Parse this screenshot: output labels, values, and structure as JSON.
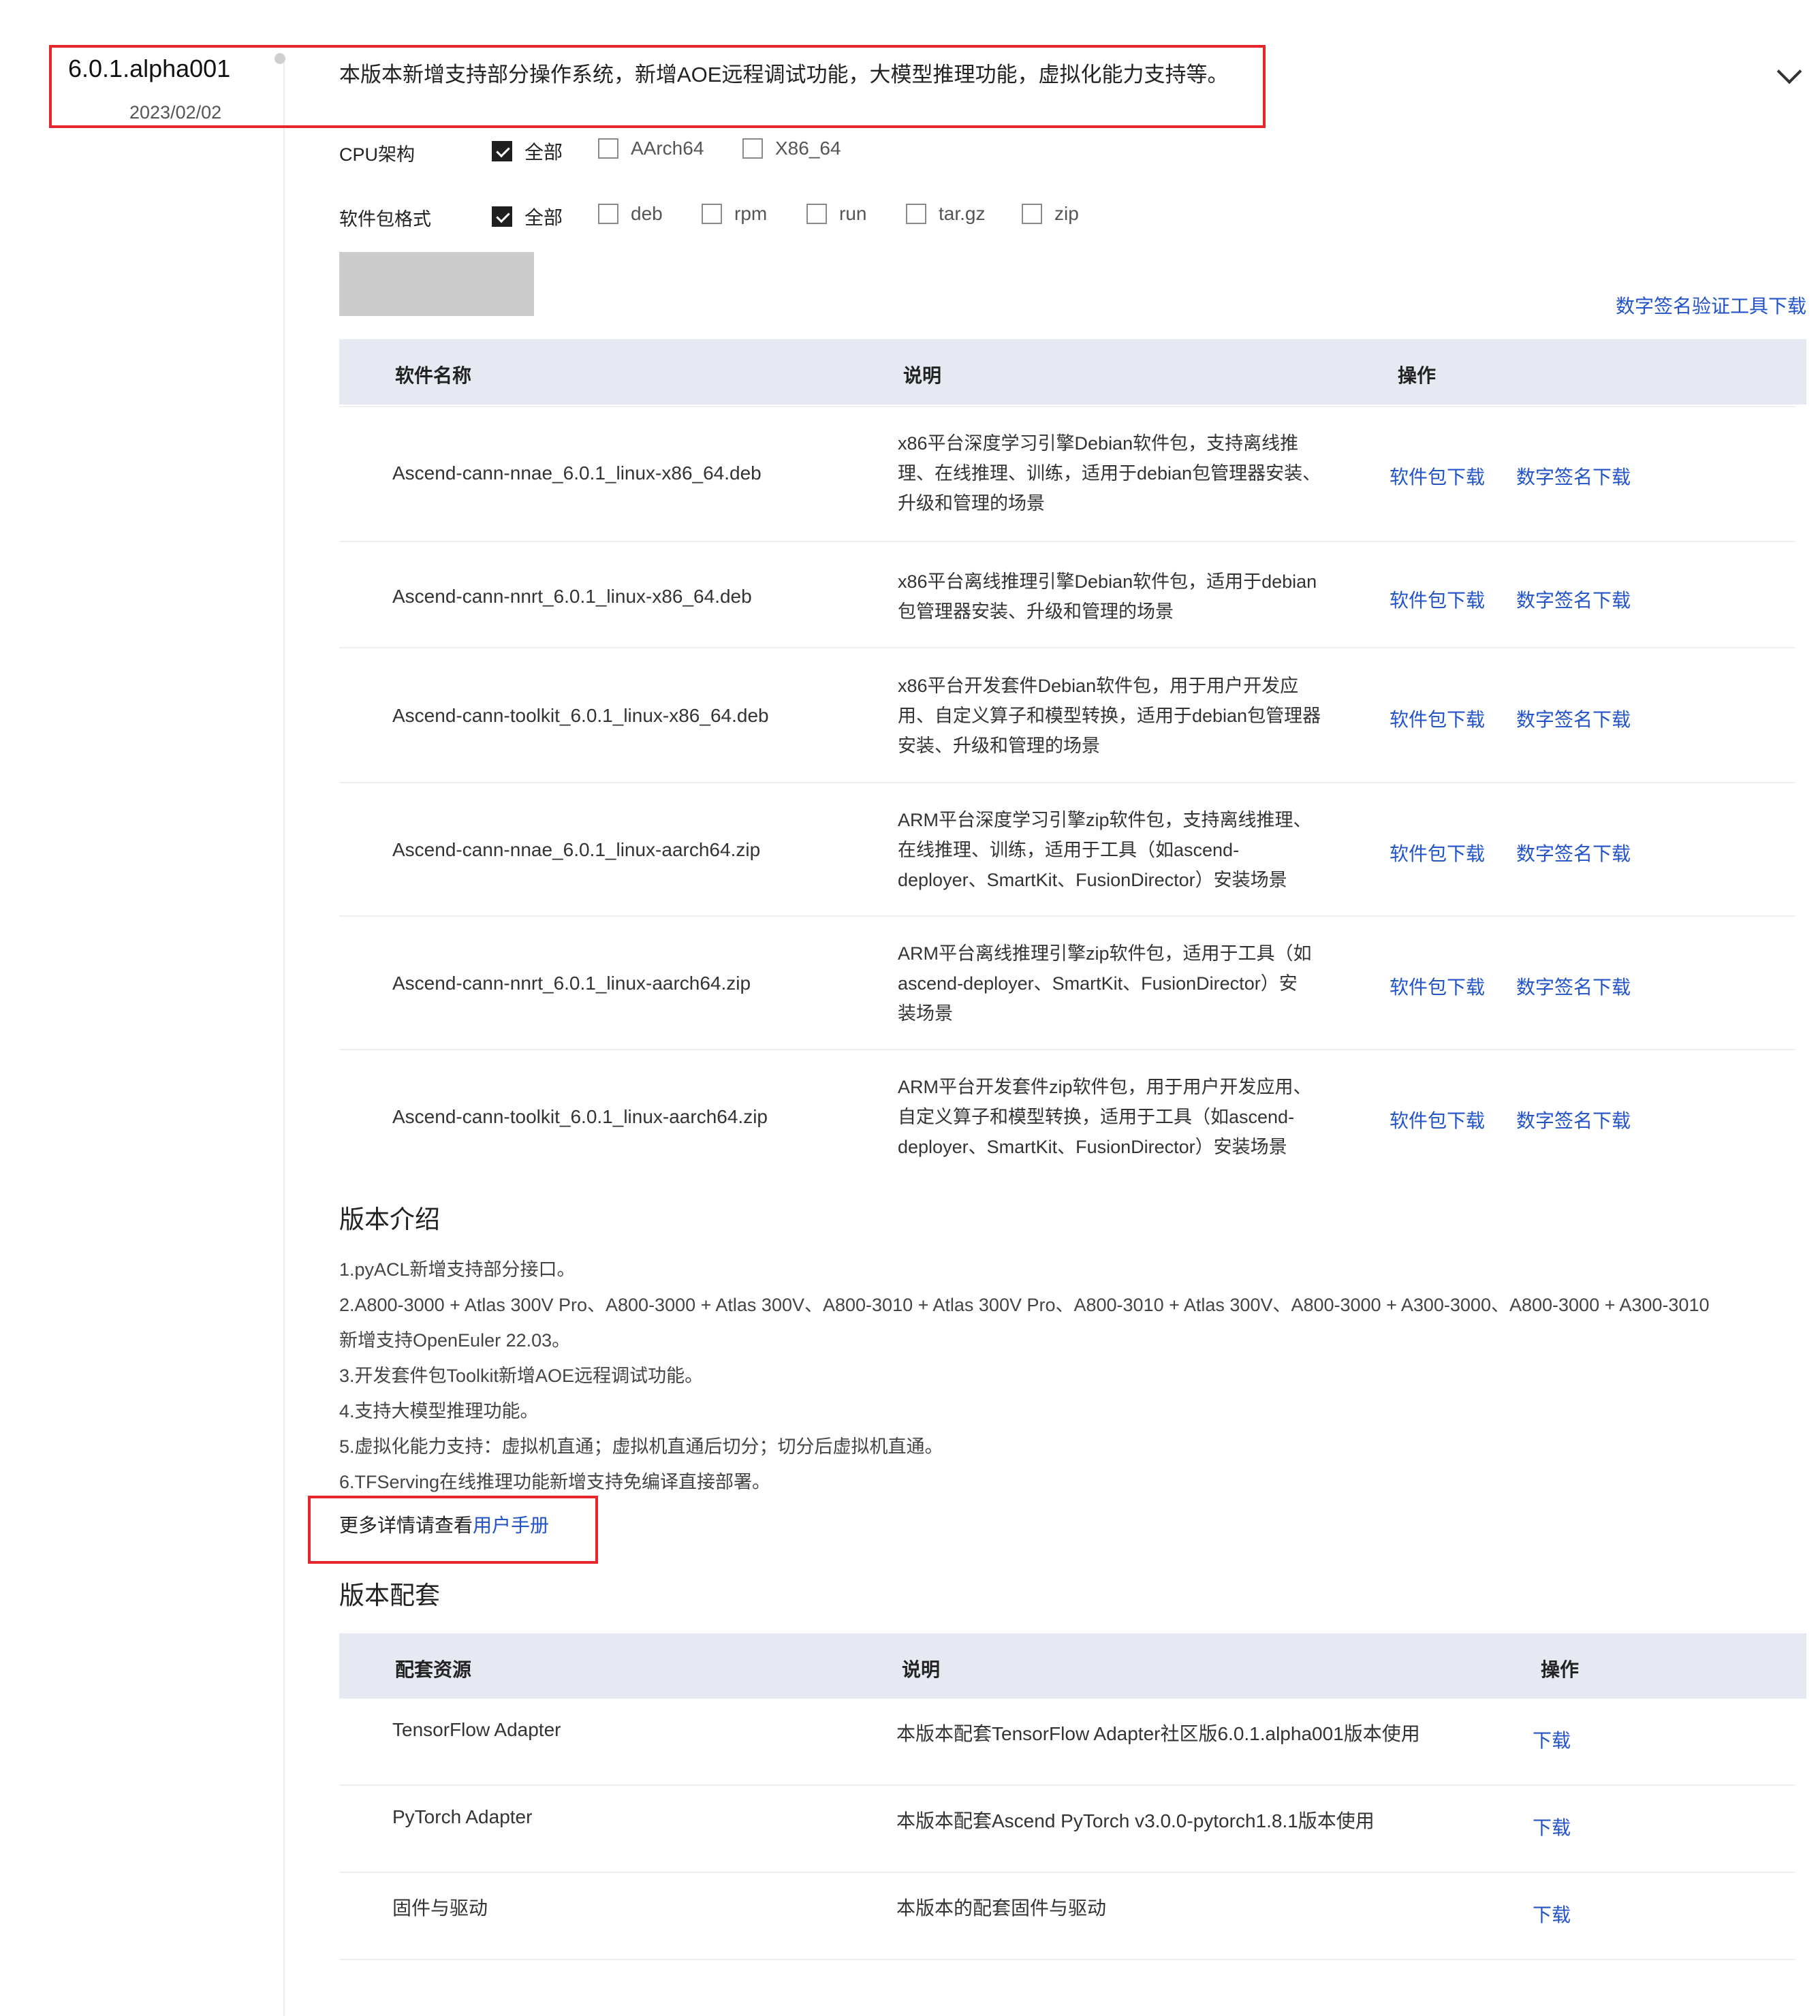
{
  "release": {
    "version": "6.0.1.alpha001",
    "date": "2023/02/02",
    "summary": "本版本新增支持部分操作系统，新增AOE远程调试功能，大模型推理功能，虚拟化能力支持等。"
  },
  "filters": {
    "cpu": {
      "label": "CPU架构",
      "options": [
        {
          "label": "全部",
          "checked": true
        },
        {
          "label": "AArch64",
          "checked": false
        },
        {
          "label": "X86_64",
          "checked": false
        }
      ]
    },
    "format": {
      "label": "软件包格式",
      "options": [
        {
          "label": "全部",
          "checked": true
        },
        {
          "label": "deb",
          "checked": false
        },
        {
          "label": "rpm",
          "checked": false
        },
        {
          "label": "run",
          "checked": false
        },
        {
          "label": "tar.gz",
          "checked": false
        },
        {
          "label": "zip",
          "checked": false
        }
      ]
    }
  },
  "signature_tool_link": "数字签名验证工具下载",
  "packages_table": {
    "headers": [
      "软件名称",
      "说明",
      "操作"
    ],
    "download_label": "软件包下载",
    "signature_label": "数字签名下载",
    "rows": [
      {
        "name": "Ascend-cann-nnae_6.0.1_linux-x86_64.deb",
        "desc": [
          "x86平台深度学习引擎Debian软件包，支持离线推",
          "理、在线推理、训练，适用于debian包管理器安装、",
          "升级和管理的场景"
        ]
      },
      {
        "name": "Ascend-cann-nnrt_6.0.1_linux-x86_64.deb",
        "desc": [
          "x86平台离线推理引擎Debian软件包，适用于debian",
          "包管理器安装、升级和管理的场景"
        ]
      },
      {
        "name": "Ascend-cann-toolkit_6.0.1_linux-x86_64.deb",
        "desc": [
          "x86平台开发套件Debian软件包，用于用户开发应",
          "用、自定义算子和模型转换，适用于debian包管理器",
          "安装、升级和管理的场景"
        ]
      },
      {
        "name": "Ascend-cann-nnae_6.0.1_linux-aarch64.zip",
        "desc": [
          "ARM平台深度学习引擎zip软件包，支持离线推理、",
          "在线推理、训练，适用于工具（如ascend-",
          "deployer、SmartKit、FusionDirector）安装场景"
        ]
      },
      {
        "name": "Ascend-cann-nnrt_6.0.1_linux-aarch64.zip",
        "desc": [
          "ARM平台离线推理引擎zip软件包，适用于工具（如",
          "ascend-deployer、SmartKit、FusionDirector）安",
          "装场景"
        ]
      },
      {
        "name": "Ascend-cann-toolkit_6.0.1_linux-aarch64.zip",
        "desc": [
          "ARM平台开发套件zip软件包，用于用户开发应用、",
          "自定义算子和模型转换，适用于工具（如ascend-",
          "deployer、SmartKit、FusionDirector）安装场景"
        ]
      }
    ]
  },
  "intro": {
    "title": "版本介绍",
    "lines": [
      "1.pyACL新增支持部分接口。",
      "2.A800-3000 + Atlas 300V Pro、A800-3000 + Atlas 300V、A800-3010 + Atlas 300V Pro、A800-3010 + Atlas 300V、A800-3000 + A300-3000、A800-3000 + A300-3010",
      "新增支持OpenEuler 22.03。",
      "3.开发套件包Toolkit新增AOE远程调试功能。",
      "4.支持大模型推理功能。",
      "5.虚拟化能力支持：虚拟机直通；虚拟机直通后切分；切分后虚拟机直通。",
      "6.TFServing在线推理功能新增支持免编译直接部署。"
    ],
    "more_prefix": "更多详情请查看",
    "more_link": "用户手册"
  },
  "companion": {
    "title": "版本配套",
    "headers": [
      "配套资源",
      "说明",
      "操作"
    ],
    "download_label": "下载",
    "rows": [
      {
        "name": "TensorFlow Adapter",
        "desc": "本版本配套TensorFlow Adapter社区版6.0.1.alpha001版本使用"
      },
      {
        "name": "PyTorch Adapter",
        "desc": "本版本配套Ascend PyTorch v3.0.0-pytorch1.8.1版本使用"
      },
      {
        "name": "固件与驱动",
        "desc": "本版本的配套固件与驱动"
      }
    ]
  },
  "colors": {
    "link": "#2253c7",
    "highlight": "#e5262c",
    "header_bg": "#e6e9f1"
  }
}
